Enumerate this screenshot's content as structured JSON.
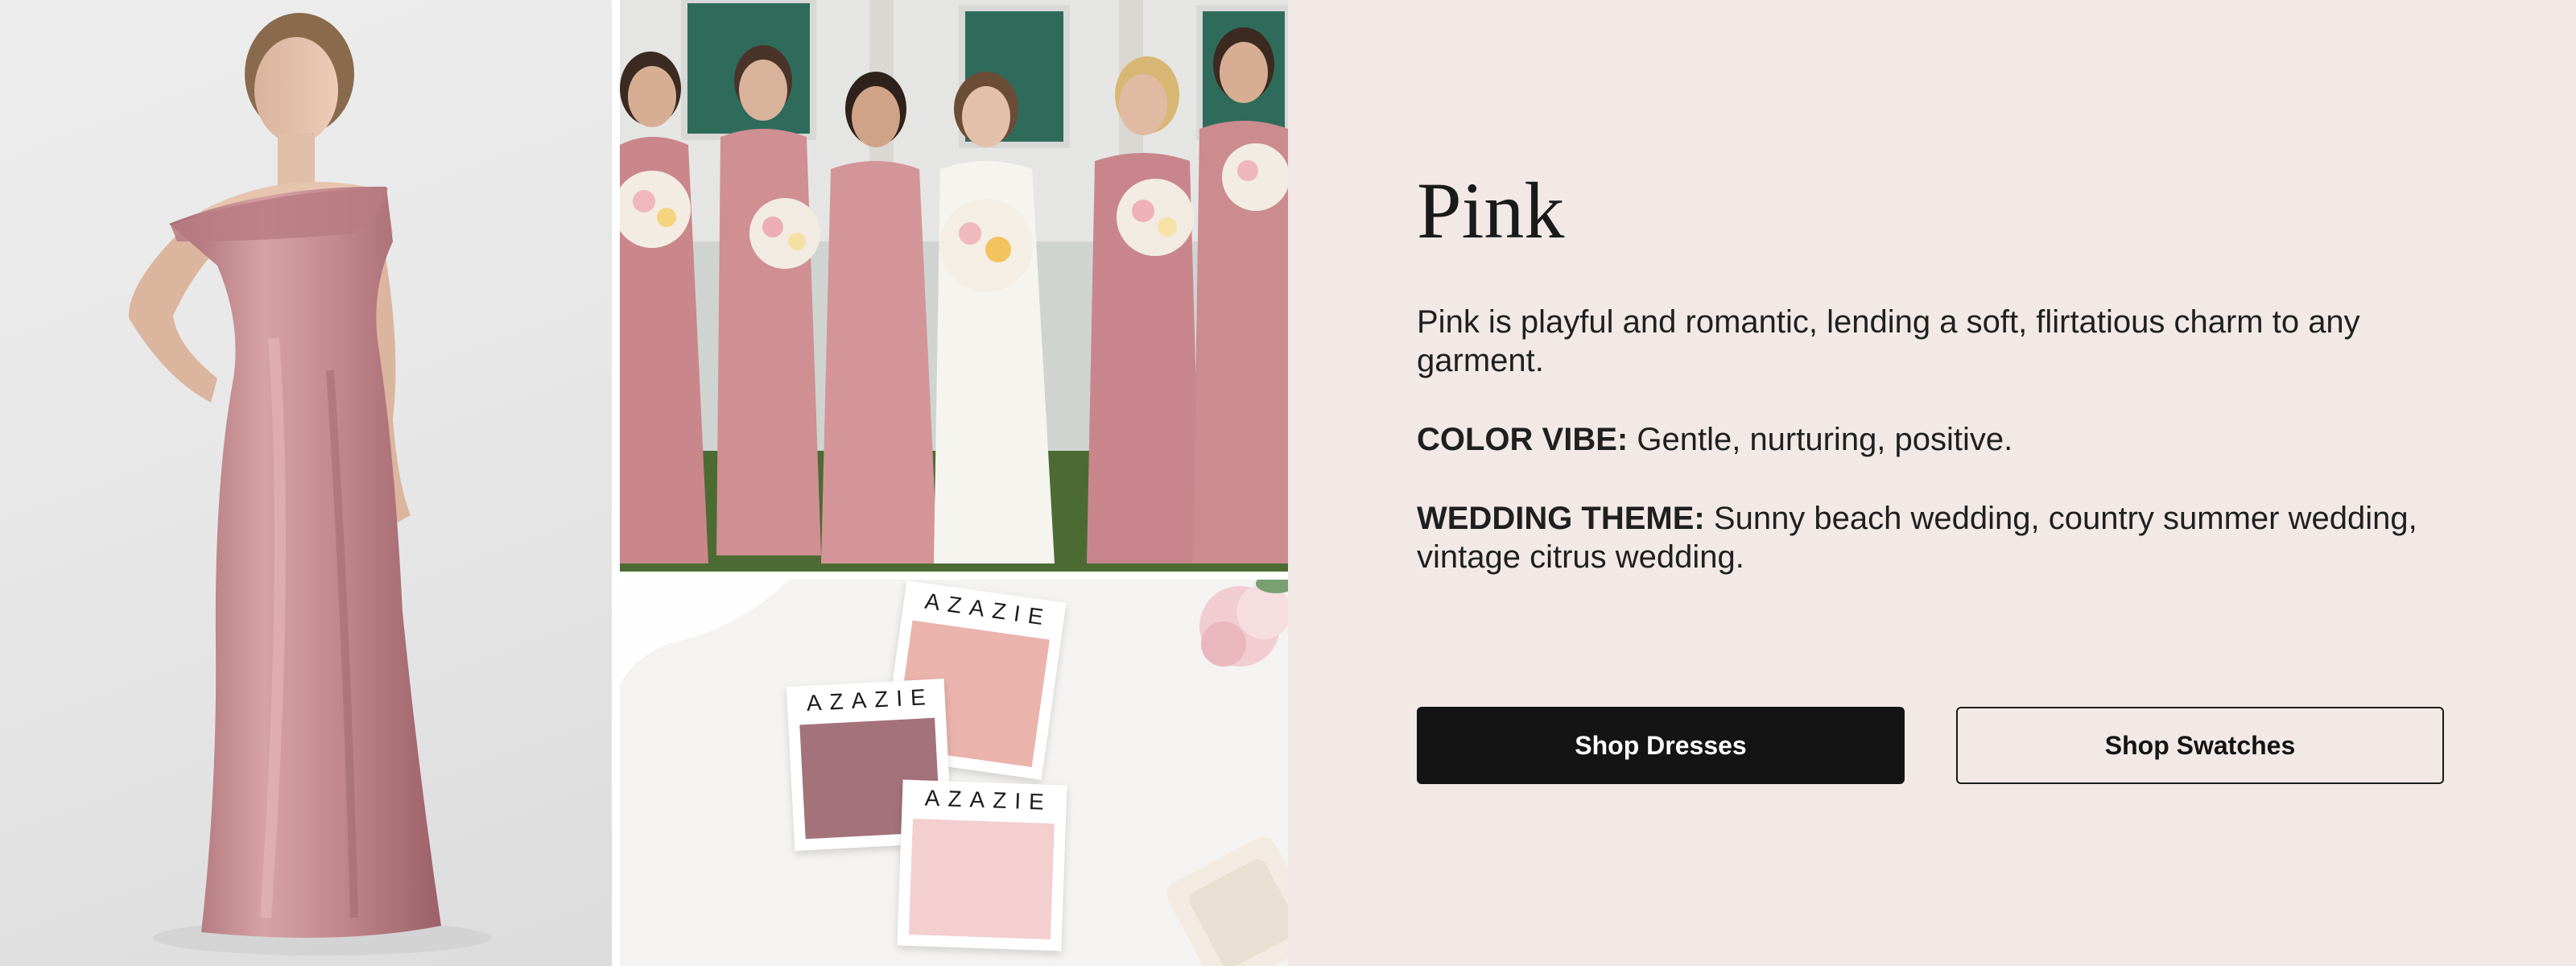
{
  "color_section": {
    "title": "Pink",
    "description": "Pink is playful and romantic, lending a soft, flirtatious charm to any garment.",
    "color_vibe": {
      "label": "COLOR VIBE:",
      "text": "Gentle, nurturing, positive."
    },
    "wedding_theme": {
      "label": "WEDDING THEME:",
      "text": "Sunny beach wedding, country summer wedding, vintage citrus wedding."
    }
  },
  "actions": {
    "shop_dresses_label": "Shop Dresses",
    "shop_swatches_label": "Shop Swatches"
  },
  "swatches": {
    "brand": "AZAZIE",
    "colors": [
      "#eab4ad",
      "#a4727a",
      "#f3cfd0"
    ]
  },
  "palette": {
    "background": "#f2e9e7",
    "dress_pink": "#c98f93",
    "primary_button": "#141414"
  }
}
